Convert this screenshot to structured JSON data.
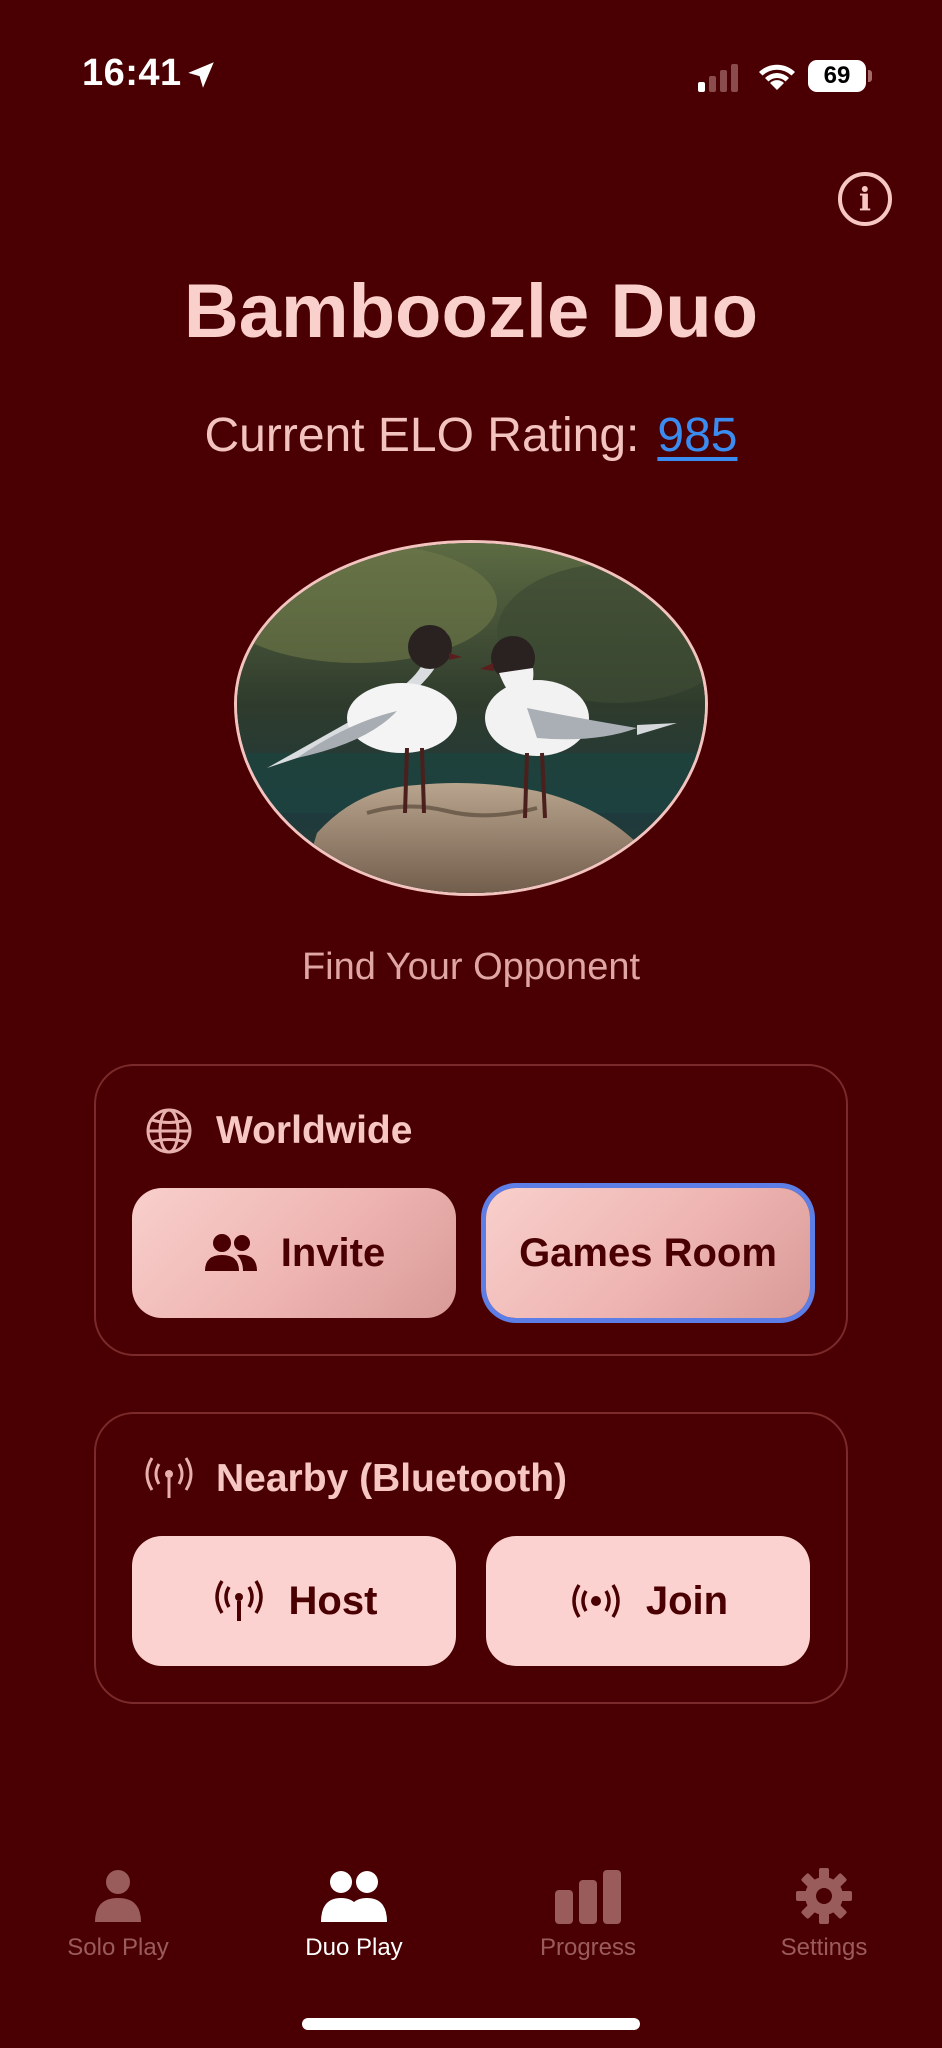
{
  "status_bar": {
    "time": "16:41",
    "battery": "69"
  },
  "app_title": "Bamboozle Duo",
  "elo": {
    "label": "Current ELO Rating:",
    "value": "985"
  },
  "find_opponent": "Find Your Opponent",
  "worldwide": {
    "heading": "Worldwide",
    "invite_label": "Invite",
    "games_room_label": "Games Room"
  },
  "nearby": {
    "heading": "Nearby (Bluetooth)",
    "host_label": "Host",
    "join_label": "Join"
  },
  "tabs": [
    {
      "label": "Solo Play",
      "icon": "person-icon"
    },
    {
      "label": "Duo Play",
      "icon": "two-people-icon"
    },
    {
      "label": "Progress",
      "icon": "bar-chart-icon"
    },
    {
      "label": "Settings",
      "icon": "gear-icon"
    }
  ],
  "active_tab": "Duo Play",
  "colors": {
    "background": "#4a0002",
    "accent_text": "#f6c7c3",
    "link": "#3a8cf0",
    "button_fill": "#f8cfcc",
    "selection_ring": "#5d7ee6"
  }
}
